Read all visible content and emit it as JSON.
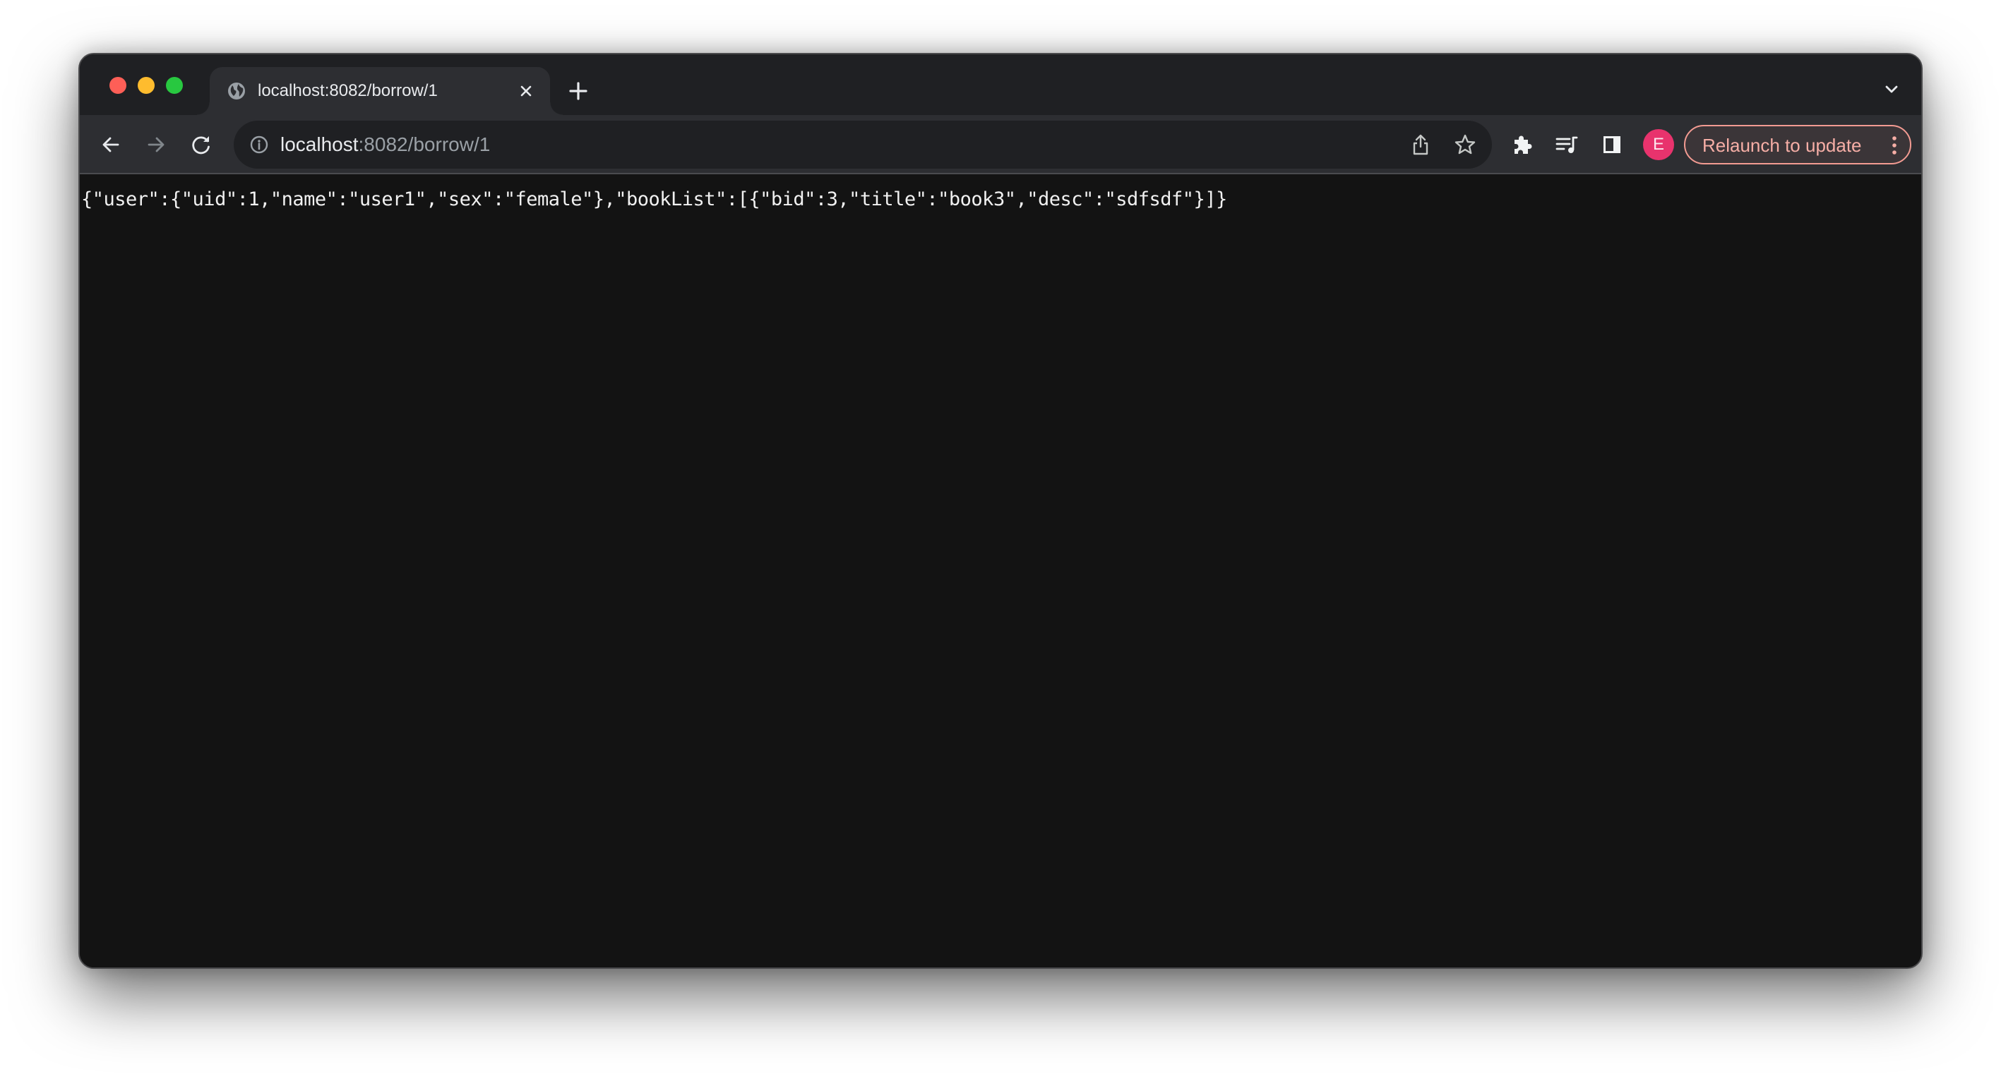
{
  "window": {
    "traffic_lights": [
      "close",
      "minimize",
      "zoom"
    ]
  },
  "tab": {
    "title": "localhost:8082/borrow/1",
    "favicon": "globe-icon",
    "close_icon": "close-icon"
  },
  "tabstrip": {
    "new_tab_icon": "plus-icon",
    "tab_search_icon": "chevron-down-icon"
  },
  "toolbar": {
    "back_icon": "arrow-left-icon",
    "forward_icon": "arrow-right-icon",
    "reload_icon": "reload-icon",
    "omnibox": {
      "host": "localhost",
      "path": ":8082/borrow/1",
      "security_icon": "info-icon"
    },
    "share_icon": "share-icon",
    "bookmark_icon": "star-icon",
    "extensions_icon": "puzzle-icon",
    "media_icon": "media-queue-icon",
    "side_panel_icon": "side-panel-icon",
    "avatar_initial": "E",
    "relaunch_label": "Relaunch to update"
  },
  "page": {
    "body_text": "{\"user\":{\"uid\":1,\"name\":\"user1\",\"sex\":\"female\"},\"bookList\":[{\"bid\":3,\"title\":\"book3\",\"desc\":\"sdfsdf\"}]}",
    "parsed": {
      "user": {
        "uid": 1,
        "name": "user1",
        "sex": "female"
      },
      "bookList": [
        {
          "bid": 3,
          "title": "book3",
          "desc": "sdfsdf"
        }
      ]
    }
  },
  "colors": {
    "avatar_bg": "#e8336d",
    "relaunch_accent": "#f29b92",
    "tab_strip_bg": "#1f2023",
    "toolbar_bg": "#2d2e32",
    "page_bg": "#131313"
  }
}
